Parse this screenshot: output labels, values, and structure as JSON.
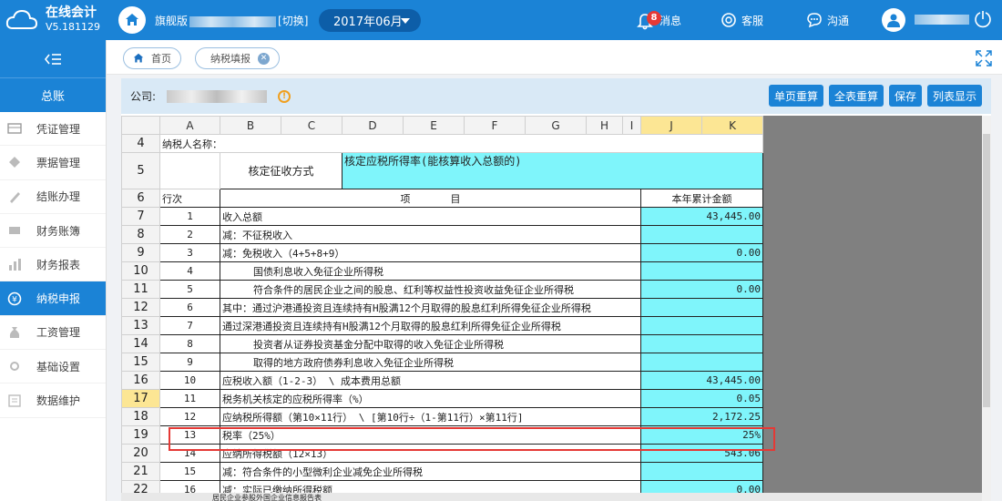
{
  "app": {
    "name": "在线会计",
    "version": "V5.181129"
  },
  "header": {
    "edition_prefix": "旗舰版",
    "switch_label": "[切换]",
    "period": "2017年06月",
    "messages_label": "消息",
    "messages_count": "8",
    "service_label": "客服",
    "chat_label": "沟通"
  },
  "sidebar": {
    "section_title": "总账",
    "items": [
      {
        "label": "凭证管理",
        "icon": "voucher-icon"
      },
      {
        "label": "票据管理",
        "icon": "bill-icon"
      },
      {
        "label": "结账办理",
        "icon": "pen-icon"
      },
      {
        "label": "财务账簿",
        "icon": "ledger-icon"
      },
      {
        "label": "财务报表",
        "icon": "bar-chart-icon"
      },
      {
        "label": "纳税申报",
        "icon": "tax-icon",
        "active": true
      },
      {
        "label": "工资管理",
        "icon": "wage-icon"
      },
      {
        "label": "基础设置",
        "icon": "settings-icon"
      },
      {
        "label": "数据维护",
        "icon": "data-icon"
      }
    ]
  },
  "tabs": [
    {
      "label": "首页"
    },
    {
      "label": "纳税填报",
      "closable": true
    }
  ],
  "toolbar": {
    "company_label": "公司:",
    "buttons": [
      "单页重算",
      "全表重算",
      "保存",
      "列表显示"
    ]
  },
  "sheet": {
    "columns": [
      "A",
      "B",
      "C",
      "D",
      "E",
      "F",
      "G",
      "H",
      "I",
      "J",
      "K"
    ],
    "selected_columns": [
      "J",
      "K"
    ],
    "selected_row": "17",
    "rows": [
      {
        "rn": "4",
        "label": "纳税人名称："
      },
      {
        "rn": "5",
        "method_label": "核定征收方式",
        "method_value": "核定应税所得率(能核算收入总额的)"
      },
      {
        "rn": "6",
        "col_a": "行次",
        "col_b": "项　　　　目",
        "col_j": "本年累计金额"
      },
      {
        "rn": "7",
        "no": "1",
        "item": "收入总额",
        "amount": "43,445.00"
      },
      {
        "rn": "8",
        "no": "2",
        "item": "减：不征税收入",
        "amount": ""
      },
      {
        "rn": "9",
        "no": "3",
        "item": "减：免税收入（4+5+8+9）",
        "amount": "0.00"
      },
      {
        "rn": "10",
        "no": "4",
        "item": "国债利息收入免征企业所得税",
        "amount": "",
        "indent": true
      },
      {
        "rn": "11",
        "no": "5",
        "item": "符合条件的居民企业之间的股息、红利等权益性投资收益免征企业所得税",
        "amount": "0.00",
        "indent": true
      },
      {
        "rn": "12",
        "no": "6",
        "item": "其中：通过沪港通投资且连续持有H股满12个月取得的股息红利所得免征企业所得税",
        "amount": ""
      },
      {
        "rn": "13",
        "no": "7",
        "item": "通过深港通投资且连续持有H股满12个月取得的股息红利所得免征企业所得税",
        "amount": ""
      },
      {
        "rn": "14",
        "no": "8",
        "item": "投资者从证券投资基金分配中取得的收入免征企业所得税",
        "amount": "",
        "indent": true
      },
      {
        "rn": "15",
        "no": "9",
        "item": "取得的地方政府债券利息收入免征企业所得税",
        "amount": "",
        "indent": true
      },
      {
        "rn": "16",
        "no": "10",
        "item": "应税收入额（1-2-3） \\ 成本费用总额",
        "amount": "43,445.00"
      },
      {
        "rn": "17",
        "no": "11",
        "item": "税务机关核定的应税所得率（%）",
        "amount": "0.05"
      },
      {
        "rn": "18",
        "no": "12",
        "item": "应纳税所得额（第10×11行） \\ [第10行÷（1-第11行）×第11行]",
        "amount": "2,172.25"
      },
      {
        "rn": "19",
        "no": "13",
        "item": "税率（25%）",
        "amount": "25%"
      },
      {
        "rn": "20",
        "no": "14",
        "item": "应纳所得税额（12×13）",
        "amount": "543.06"
      },
      {
        "rn": "21",
        "no": "15",
        "item": "减：符合条件的小型微利企业减免企业所得税",
        "amount": ""
      },
      {
        "rn": "22",
        "no": "16",
        "item": "减：实际已缴纳所得税额",
        "amount": "0.00"
      }
    ],
    "sheet_tab": "居民企业参股外国企业信息报告表"
  }
}
